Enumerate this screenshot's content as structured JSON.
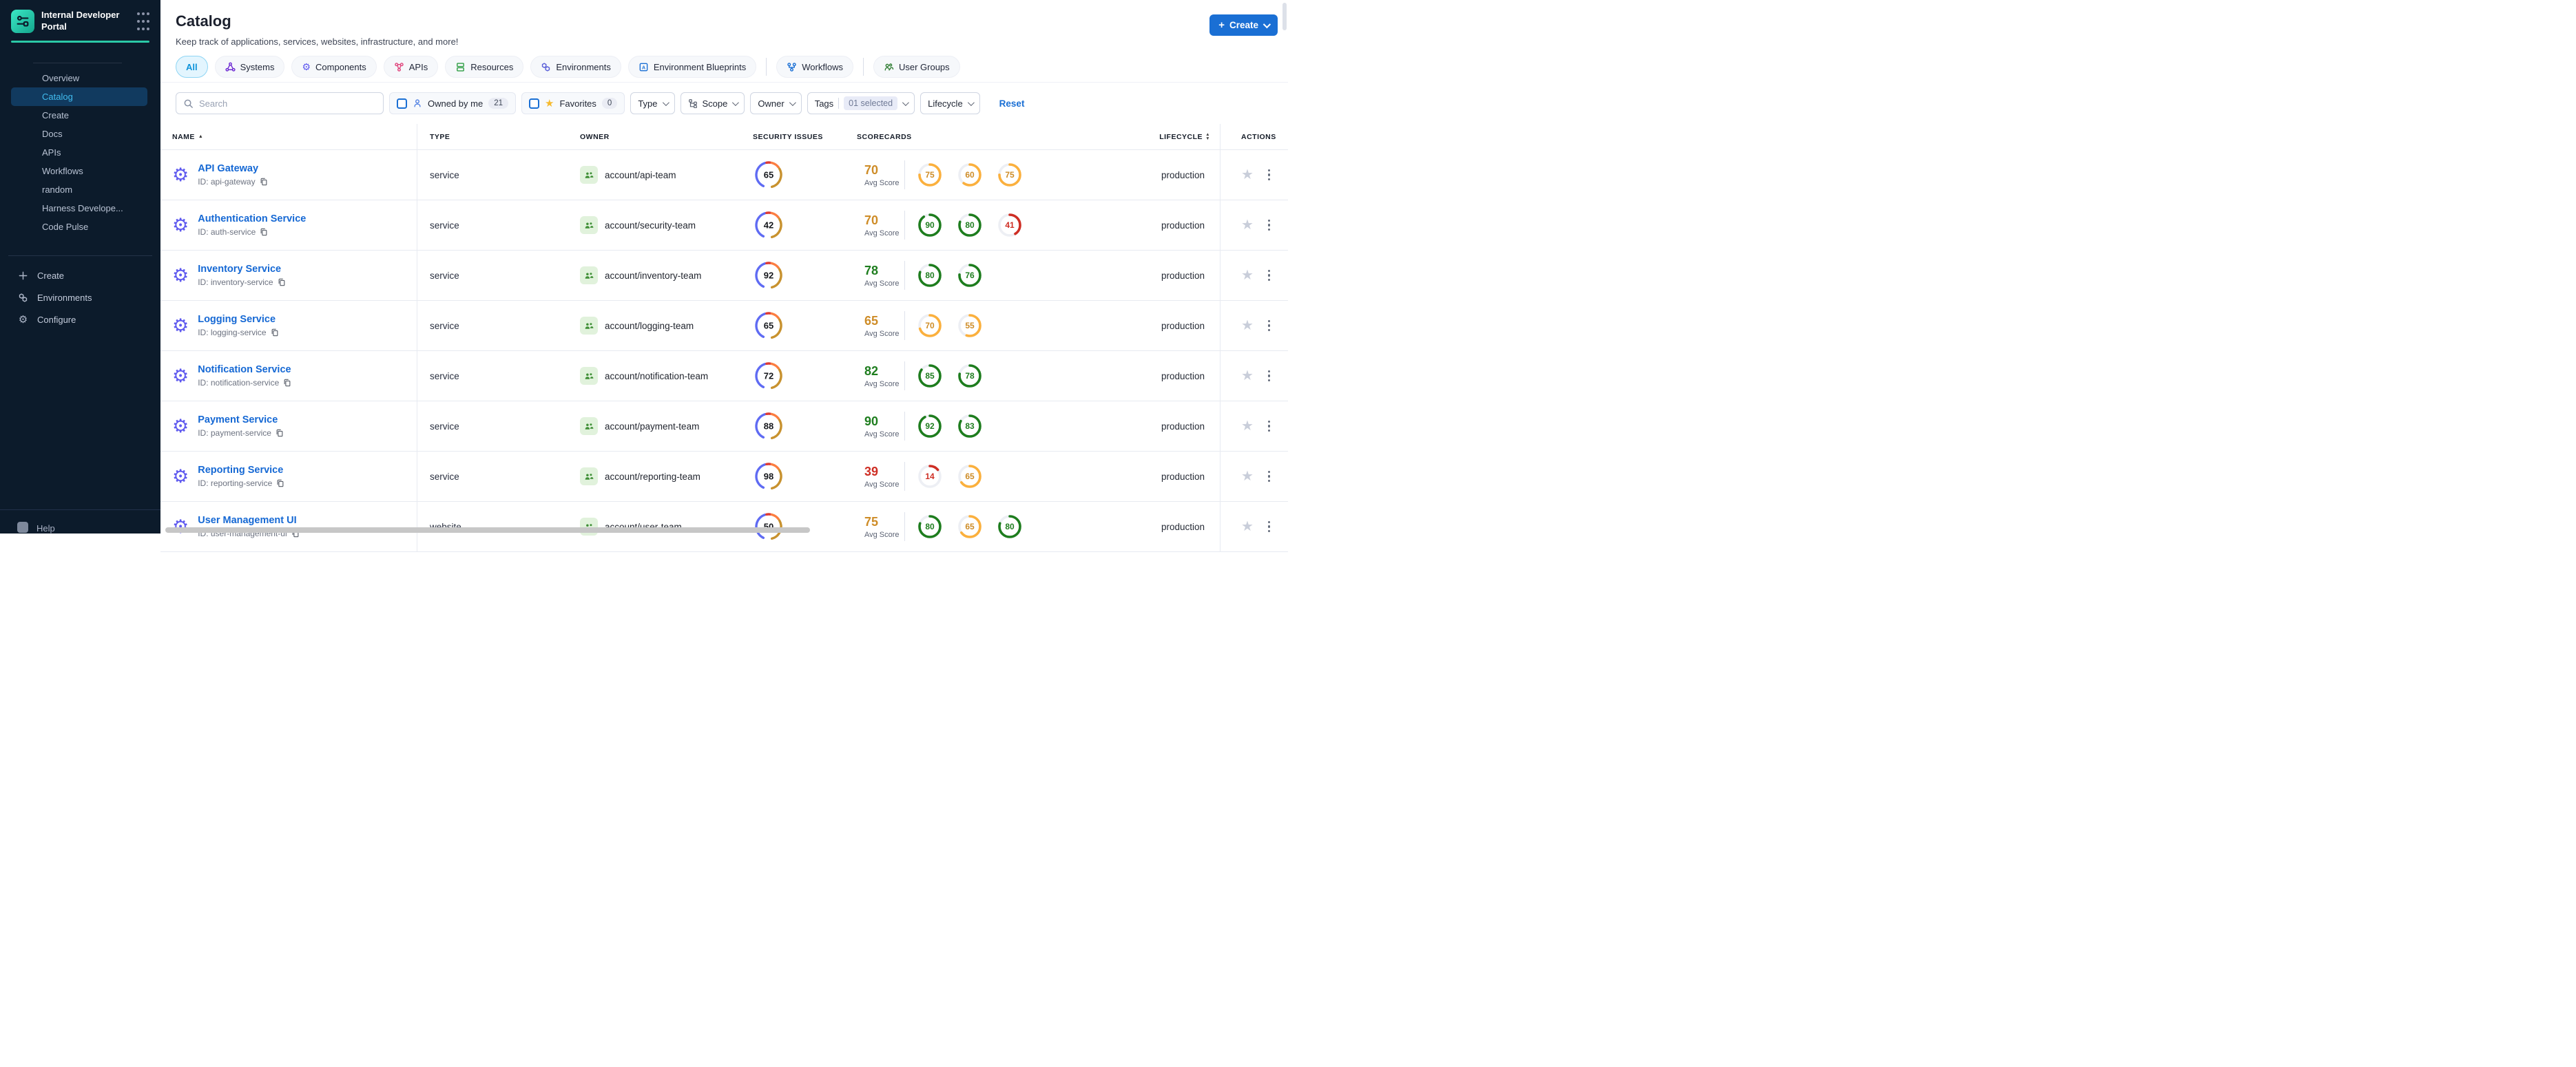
{
  "brand": {
    "title": "Internal Developer Portal"
  },
  "sidebar": {
    "items": [
      {
        "label": "Overview",
        "active": false
      },
      {
        "label": "Catalog",
        "active": true
      },
      {
        "label": "Create",
        "active": false
      },
      {
        "label": "Docs",
        "active": false
      },
      {
        "label": "APIs",
        "active": false
      },
      {
        "label": "Workflows",
        "active": false
      },
      {
        "label": "random",
        "active": false
      },
      {
        "label": "Harness Develope...",
        "active": false
      },
      {
        "label": "Code Pulse",
        "active": false
      }
    ],
    "bottom": [
      {
        "label": "Create",
        "icon": "plus"
      },
      {
        "label": "Environments",
        "icon": "hexagons"
      },
      {
        "label": "Configure",
        "icon": "gear"
      }
    ],
    "help": "Help"
  },
  "header": {
    "title": "Catalog",
    "subtitle": "Keep track of applications, services, websites, infrastructure, and more!",
    "create_button": "Create"
  },
  "tabs": [
    {
      "label": "All",
      "icon": "",
      "icon_color": "",
      "active": true,
      "divider_after": false
    },
    {
      "label": "Systems",
      "icon": "systems",
      "icon_color": "#6D28D2",
      "active": false,
      "divider_after": false
    },
    {
      "label": "Components",
      "icon": "components",
      "icon_color": "#5E59EF",
      "active": false,
      "divider_after": false
    },
    {
      "label": "APIs",
      "icon": "apis",
      "icon_color": "#E0447C",
      "active": false,
      "divider_after": false
    },
    {
      "label": "Resources",
      "icon": "resources",
      "icon_color": "#2F9E44",
      "active": false,
      "divider_after": false
    },
    {
      "label": "Environments",
      "icon": "environments",
      "icon_color": "#5A5FD8",
      "active": false,
      "divider_after": false
    },
    {
      "label": "Environment Blueprints",
      "icon": "blueprints",
      "icon_color": "#1A6FD4",
      "active": false,
      "divider_after": true
    },
    {
      "label": "Workflows",
      "icon": "workflows",
      "icon_color": "#1A6FD4",
      "active": false,
      "divider_after": true
    },
    {
      "label": "User Groups",
      "icon": "user-groups",
      "icon_color": "#2F7D32",
      "active": false,
      "divider_after": false
    }
  ],
  "filters": {
    "search_placeholder": "Search",
    "owned_by_me": {
      "label": "Owned by me",
      "count": "21"
    },
    "favorites": {
      "label": "Favorites",
      "count": "0"
    },
    "type_label": "Type",
    "scope_label": "Scope",
    "owner_label": "Owner",
    "tags_label": "Tags",
    "tags_value": "01 selected",
    "lifecycle_label": "Lifecycle",
    "reset_label": "Reset"
  },
  "table": {
    "columns": {
      "name": "Name",
      "type": "Type",
      "owner": "Owner",
      "security": "Security Issues",
      "scorecards": "Scorecards",
      "lifecycle": "Lifecycle",
      "actions": "Actions"
    },
    "id_prefix": "ID:",
    "avg_label": "Avg Score",
    "rows": [
      {
        "name": "API Gateway",
        "id": "api-gateway",
        "type": "service",
        "owner": "account/api-team",
        "security": 65,
        "avg": {
          "value": 70,
          "level": "amber"
        },
        "scores": [
          {
            "value": 75,
            "level": "amber"
          },
          {
            "value": 60,
            "level": "amber"
          },
          {
            "value": 75,
            "level": "amber"
          }
        ],
        "lifecycle": "production"
      },
      {
        "name": "Authentication Service",
        "id": "auth-service",
        "type": "service",
        "owner": "account/security-team",
        "security": 42,
        "avg": {
          "value": 70,
          "level": "amber"
        },
        "scores": [
          {
            "value": 90,
            "level": "green"
          },
          {
            "value": 80,
            "level": "green"
          },
          {
            "value": 41,
            "level": "red"
          }
        ],
        "lifecycle": "production"
      },
      {
        "name": "Inventory Service",
        "id": "inventory-service",
        "type": "service",
        "owner": "account/inventory-team",
        "security": 92,
        "avg": {
          "value": 78,
          "level": "green"
        },
        "scores": [
          {
            "value": 80,
            "level": "green"
          },
          {
            "value": 76,
            "level": "green"
          }
        ],
        "lifecycle": "production"
      },
      {
        "name": "Logging Service",
        "id": "logging-service",
        "type": "service",
        "owner": "account/logging-team",
        "security": 65,
        "avg": {
          "value": 65,
          "level": "amber"
        },
        "scores": [
          {
            "value": 70,
            "level": "amber"
          },
          {
            "value": 55,
            "level": "amber"
          }
        ],
        "lifecycle": "production"
      },
      {
        "name": "Notification Service",
        "id": "notification-service",
        "type": "service",
        "owner": "account/notification-team",
        "security": 72,
        "avg": {
          "value": 82,
          "level": "green"
        },
        "scores": [
          {
            "value": 85,
            "level": "green"
          },
          {
            "value": 78,
            "level": "green"
          }
        ],
        "lifecycle": "production"
      },
      {
        "name": "Payment Service",
        "id": "payment-service",
        "type": "service",
        "owner": "account/payment-team",
        "security": 88,
        "avg": {
          "value": 90,
          "level": "green"
        },
        "scores": [
          {
            "value": 92,
            "level": "green"
          },
          {
            "value": 83,
            "level": "green"
          }
        ],
        "lifecycle": "production"
      },
      {
        "name": "Reporting Service",
        "id": "reporting-service",
        "type": "service",
        "owner": "account/reporting-team",
        "security": 98,
        "avg": {
          "value": 39,
          "level": "red"
        },
        "scores": [
          {
            "value": 14,
            "level": "red"
          },
          {
            "value": 65,
            "level": "amber"
          }
        ],
        "lifecycle": "production"
      },
      {
        "name": "User Management UI",
        "id": "user-management-ui",
        "type": "website",
        "owner": "account/user-team",
        "security": 50,
        "avg": {
          "value": 75,
          "level": "amber"
        },
        "scores": [
          {
            "value": 80,
            "level": "green"
          },
          {
            "value": 65,
            "level": "amber"
          },
          {
            "value": 80,
            "level": "green"
          }
        ],
        "lifecycle": "production"
      }
    ]
  },
  "palette": {
    "accent_teal": "#2BC9A7",
    "primary_blue": "#1A6FD4",
    "link_blue": "#1568D4",
    "security_segments": [
      {
        "from": 205,
        "to": 343,
        "color": "#5F6BF3"
      },
      {
        "from": 350,
        "to": 368,
        "color": "#DE3B33"
      },
      {
        "from": 374,
        "to": 412,
        "color": "#FC7E41"
      },
      {
        "from": 420,
        "to": 525,
        "color": "#C8922F"
      }
    ],
    "levels": {
      "amber": {
        "arc": "#FBB03D",
        "text": "#CE8C27"
      },
      "green": {
        "arc": "#1E7D1E",
        "text": "#1E7D1E"
      },
      "red": {
        "arc": "#CE2E24",
        "text": "#CE2E24"
      }
    }
  }
}
